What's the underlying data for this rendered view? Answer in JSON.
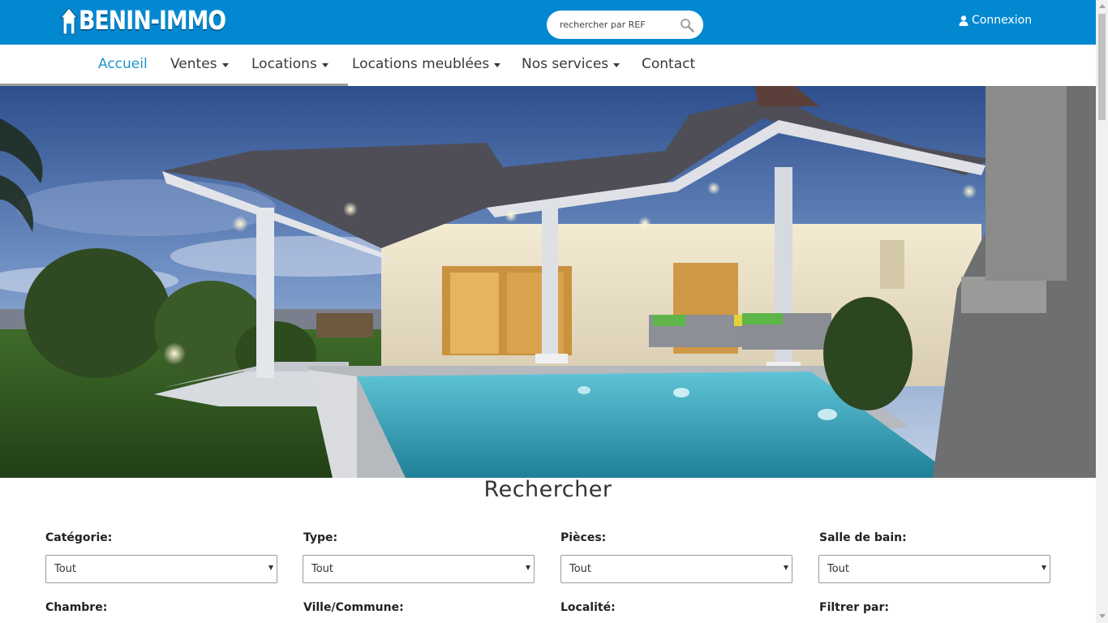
{
  "brand": {
    "name": "BENIN-IMMO",
    "color": "#0288d1"
  },
  "search": {
    "placeholder": "rechercher par REF",
    "icon": "search-icon"
  },
  "account": {
    "login_label": "Connexion",
    "icon": "user-icon"
  },
  "nav": {
    "items": [
      {
        "label": "Accueil",
        "active": true,
        "dropdown": false
      },
      {
        "label": "Ventes",
        "active": false,
        "dropdown": true
      },
      {
        "label": "Locations",
        "active": false,
        "dropdown": true
      },
      {
        "label": "Locations meublées",
        "active": false,
        "dropdown": true
      },
      {
        "label": "Nos services",
        "active": false,
        "dropdown": true
      },
      {
        "label": "Contact",
        "active": false,
        "dropdown": false
      }
    ],
    "active_color": "#2196c9"
  },
  "search_form": {
    "title": "Rechercher",
    "fields": [
      {
        "label": "Catégorie:",
        "value": "Tout"
      },
      {
        "label": "Type:",
        "value": "Tout"
      },
      {
        "label": "Pièces:",
        "value": "Tout"
      },
      {
        "label": "Salle de bain:",
        "value": "Tout"
      },
      {
        "label": "Chambre:"
      },
      {
        "label": "Ville/Commune:"
      },
      {
        "label": "Localité:"
      },
      {
        "label": "Filtrer par:"
      }
    ]
  }
}
